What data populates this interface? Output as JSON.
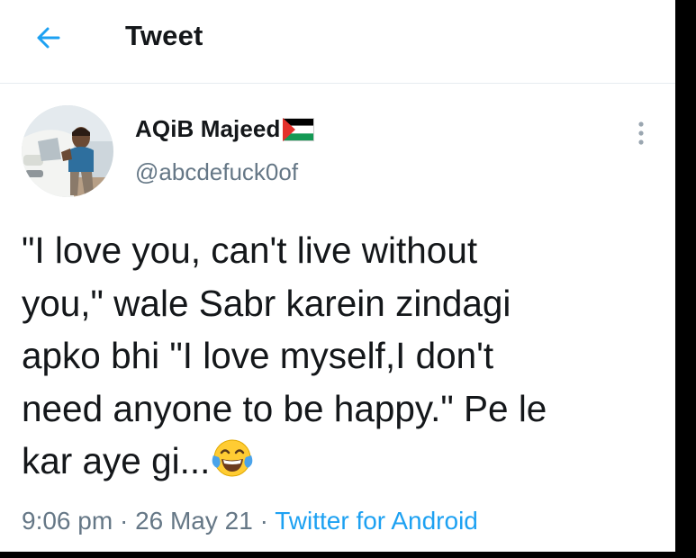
{
  "header": {
    "title": "Tweet"
  },
  "tweet": {
    "author": {
      "display_name": "AQiB Majeed",
      "handle": "@abcdefuck0of",
      "flag": "palestine-flag"
    },
    "text_lines": [
      "\"I love you, can't live without",
      "you,\" wale Sabr karein zindagi",
      "apko bhi \"I love myself,I don't",
      "need anyone to be happy.\" Pe le",
      "kar aye gi..."
    ],
    "emoji": "face-with-tears-of-joy",
    "time": "9:06 pm",
    "date": "26 May 21",
    "separator": "·",
    "source": "Twitter for Android"
  },
  "colors": {
    "accent": "#1da1f2",
    "text_primary": "#14171a",
    "text_secondary": "#657786",
    "divider": "#e6ecf0",
    "frame": "#000000"
  }
}
